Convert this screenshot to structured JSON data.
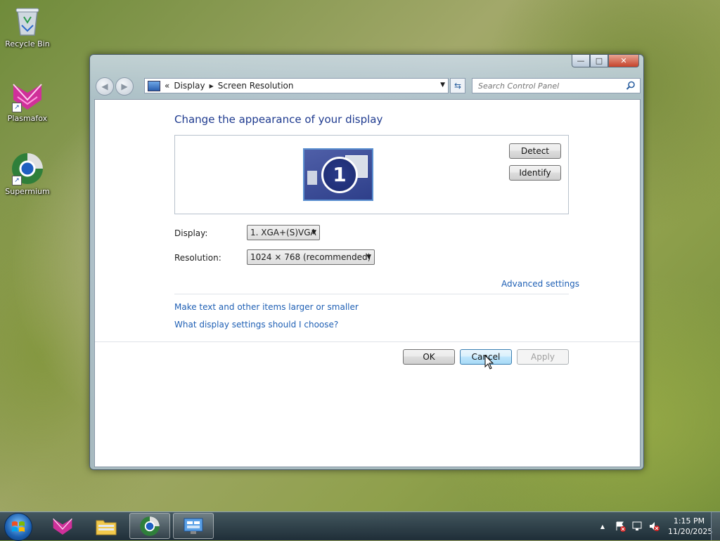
{
  "desktop": {
    "icons": [
      {
        "label": "Recycle Bin"
      },
      {
        "label": "Plasmafox"
      },
      {
        "label": "Supermium"
      }
    ]
  },
  "window": {
    "caption": {
      "minimize": "—",
      "maximize": "□",
      "close": "✕"
    },
    "address": {
      "prefix": "«",
      "crumbs": [
        "Display",
        "Screen Resolution"
      ]
    },
    "search": {
      "placeholder": "Search Control Panel"
    },
    "heading": "Change the appearance of your display",
    "monitor_number": "1",
    "buttons": {
      "detect": "Detect",
      "identify": "Identify",
      "ok": "OK",
      "cancel": "Cancel",
      "apply": "Apply"
    },
    "display": {
      "label": "Display:",
      "value": "1. XGA+(S)VGA"
    },
    "resolution": {
      "label": "Resolution:",
      "value": "1024 × 768 (recommended)"
    },
    "links": {
      "advanced": "Advanced settings",
      "larger": "Make text and other items larger or smaller",
      "choose": "What display settings should I choose?"
    }
  },
  "taskbar": {
    "clock": {
      "time": "1:15 PM",
      "date": "11/20/2025"
    },
    "tray_expand": "▲"
  }
}
